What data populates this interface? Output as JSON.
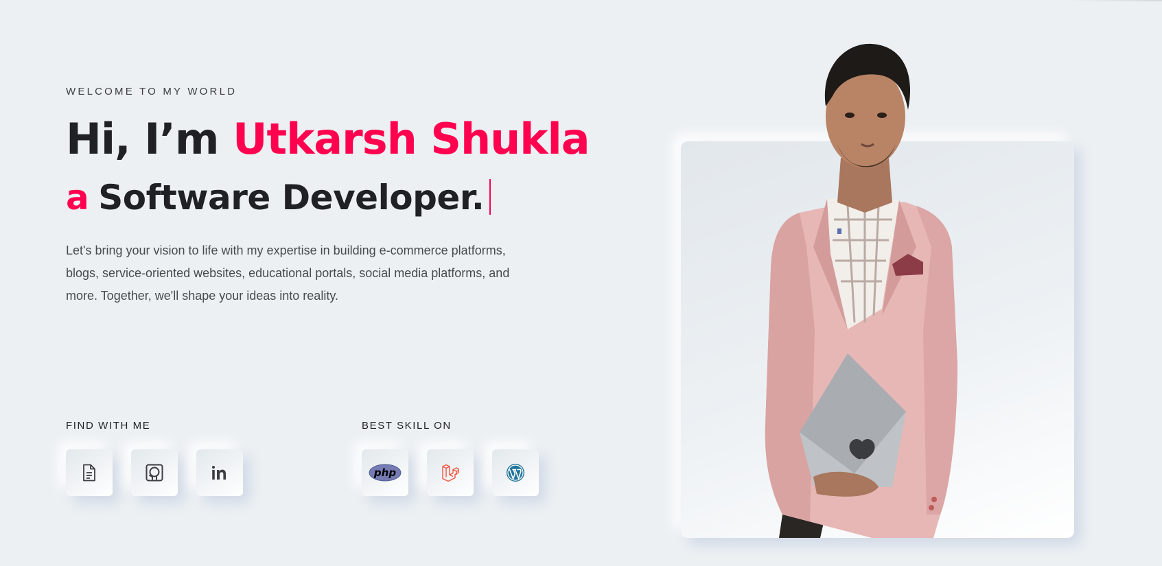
{
  "hero": {
    "subtitle": "WELCOME TO MY WORLD",
    "greeting": "Hi, I’m ",
    "name": "Utkarsh Shukla",
    "article": "a",
    "role": "Software Developer.",
    "description": "Let's bring your vision to life with my expertise in building e-commerce platforms, blogs, service-oriented websites, educational portals, social media platforms, and more. Together, we'll shape your ideas into reality."
  },
  "social": {
    "title": "FIND WITH ME",
    "items": [
      {
        "icon": "document-icon",
        "label": "Resume"
      },
      {
        "icon": "github-icon",
        "label": "GitHub"
      },
      {
        "icon": "linkedin-icon",
        "label": "LinkedIn"
      }
    ]
  },
  "skills": {
    "title": "BEST SKILL ON",
    "items": [
      {
        "icon": "php-icon",
        "label": "php"
      },
      {
        "icon": "laravel-icon",
        "label": "Laravel"
      },
      {
        "icon": "wordpress-icon",
        "label": "WordPress"
      }
    ]
  },
  "colors": {
    "background": "#ecf0f3",
    "accent": "#ff014f",
    "heading": "#1f2125",
    "body_text": "#474a4f"
  }
}
